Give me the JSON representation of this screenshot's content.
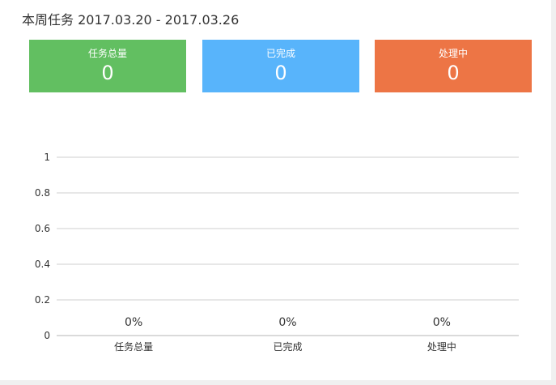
{
  "panel": {
    "title": "本周任务 2017.03.20 - 2017.03.26"
  },
  "stats": [
    {
      "label": "任务总量",
      "value": "0",
      "color": "#62bf61"
    },
    {
      "label": "已完成",
      "value": "0",
      "color": "#58b4fb"
    },
    {
      "label": "处理中",
      "value": "0",
      "color": "#ed7545"
    }
  ],
  "chart_data": {
    "type": "bar",
    "categories": [
      "任务总量",
      "已完成",
      "处理中"
    ],
    "values": [
      0,
      0,
      0
    ],
    "data_labels": [
      "0%",
      "0%",
      "0%"
    ],
    "yticks": [
      "0",
      "0.2",
      "0.4",
      "0.6",
      "0.8",
      "1"
    ],
    "ylim": [
      0,
      1
    ],
    "grid": true,
    "title": "",
    "xlabel": "",
    "ylabel": ""
  }
}
